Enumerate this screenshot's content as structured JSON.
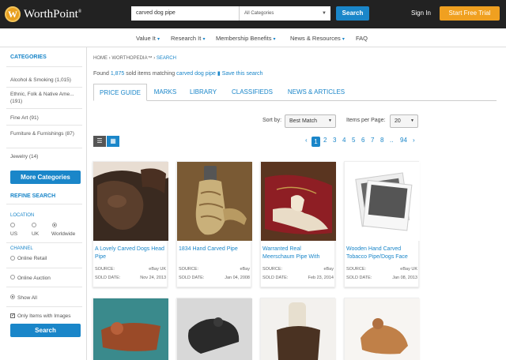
{
  "header": {
    "logo_text": "WorthPoint",
    "logo_mark": "W",
    "logo_reg": "®",
    "search_value": "carved dog pipe",
    "category_value": "All Categories",
    "search_button": "Search",
    "signin": "Sign In",
    "trial_button": "Start Free Trial"
  },
  "nav": {
    "items": [
      "Value It",
      "Research It",
      "Membership Benefits",
      "News & Resources",
      "FAQ"
    ]
  },
  "sidebar": {
    "categories_heading": "CATEGORIES",
    "categories": [
      "Alcohol & Smoking (1,015)",
      "Ethnic, Folk & Native Ame... (191)",
      "Fine Art (91)",
      "Furniture & Furnishings (87)",
      "Jewelry (14)"
    ],
    "more_categories": "More Categories",
    "refine_heading": "REFINE SEARCH",
    "location_label": "LOCATION",
    "locations": [
      "US",
      "UK",
      "Worldwide"
    ],
    "channel_label": "CHANNEL",
    "channels": [
      "Online Retail",
      "Online Auction",
      "Show All"
    ],
    "images_only": "Only Items with Images",
    "search_button": "Search"
  },
  "main": {
    "breadcrumb": [
      "HOME",
      "WORTHOPEDIA™",
      "SEARCH"
    ],
    "found_prefix": "Found",
    "found_count": "1,875",
    "found_middle": "sold items matching",
    "found_query": "carved dog pipe",
    "save_search": "Save this search",
    "tabs": [
      "PRICE GUIDE",
      "MARKS",
      "LIBRARY",
      "CLASSIFIEDS",
      "NEWS & ARTICLES"
    ],
    "sort_label": "Sort by:",
    "sort_value": "Best Match",
    "ipp_label": "Items per Page:",
    "ipp_value": "20",
    "pagination": [
      "‹",
      "1",
      "2",
      "3",
      "4",
      "5",
      "6",
      "7",
      "8",
      "..",
      "94",
      "›"
    ]
  },
  "items": [
    {
      "title": "A Lovely Carved Dogs Head Pipe",
      "source_label": "SOURCE:",
      "source": "eBay UK",
      "date_label": "SOLD DATE:",
      "date": "Nov 24, 2013"
    },
    {
      "title": "1834 Hand Carved Pipe",
      "source_label": "SOURCE:",
      "source": "eBay",
      "date_label": "SOLD DATE:",
      "date": "Jan 04, 2008"
    },
    {
      "title": "Warranted Real Meerschaum Pipe With",
      "source_label": "SOURCE:",
      "source": "eBay",
      "date_label": "SOLD DATE:",
      "date": "Feb 23, 2014"
    },
    {
      "title": "Wooden Hand Carved Tobacco Pipe/Dogs Face",
      "source_label": "SOURCE:",
      "source": "eBay UK",
      "date_label": "SOLD DATE:",
      "date": "Jan 08, 2013"
    }
  ],
  "colors": {
    "accent": "#1a86c9",
    "trial": "#f0a020",
    "topbar": "#222222"
  }
}
